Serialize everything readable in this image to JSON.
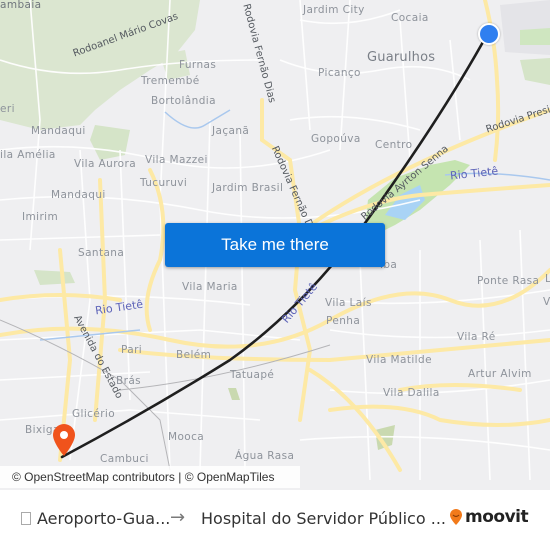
{
  "map": {
    "labels": {
      "cantareira": "ambaia",
      "rodoanel": "Rodoanel Mário Covas",
      "furnas": "Furnas",
      "tremembe": "Tremembé",
      "bortolandia": "Bortolândia",
      "jacana": "Jaçanã",
      "mandaqui_n": "Mandaqui",
      "eri": "eri",
      "vila_amelia": "ila Amélia",
      "vila_aurora": "Vila Aurora",
      "vila_mazzei": "Vila Mazzei",
      "tucuruvi": "Tucuruvi",
      "jardim_brasil": "Jardim Brasil",
      "mandaqui_s": "Mandaqui",
      "imirim": "Imirim",
      "santana": "Santana",
      "vila_maria": "Vila Maria",
      "rio_tiete_w": "Rio Tietê",
      "avenida_estado": "Avenida do Estado",
      "pari": "Pari",
      "belem": "Belém",
      "bras": "Brás",
      "tatuape": "Tatuapé",
      "glicerio": "Glicério",
      "bixiga": "Bixiga",
      "mooca": "Mooca",
      "cambuci": "Cambuci",
      "agua_rasa": "Água Rasa",
      "jardim_city": "Jardim City",
      "cocaia": "Cocaia",
      "guarulhos": "Guarulhos",
      "picanco": "Picanço",
      "gopouva": "Gopoúva",
      "centro": "Centro",
      "rodovia_presidente": "Rodovia Presid",
      "ayrton_senna": "Rodovia Ayrton Senna",
      "rio_tiete_e": "Rio Tietê",
      "fernao_dias_n": "Rodovia Fernão Dias",
      "fernao_dias_s": "Rodovia Fernão D",
      "iba": "iba",
      "ponte_rasa": "Ponte Rasa",
      "vila_lais": "Vila Laís",
      "penha": "Penha",
      "rio_tiete_c": "Rio Tietê",
      "vila_re": "Vila Ré",
      "vila_matilde": "Vila Matilde",
      "artur_alvim": "Artur Alvim",
      "vila_dalila": "Vila Dalila",
      "edge_l": "L",
      "edge_v": "V"
    },
    "cta_label": "Take me there",
    "attribution": "© OpenStreetMap contributors | © OpenMapTiles",
    "colors": {
      "route": "#1f1f1f",
      "origin_marker": "#2f7ff0",
      "destination_marker": "#f0531c",
      "cta": "#0b74d9",
      "major_road": "#fde9a5",
      "park": "#c5e4b0",
      "forest": "#d8e6cc",
      "water": "#a9d3f5"
    }
  },
  "footer": {
    "origin_icon": "bus-stop-icon",
    "origin": "Aeroporto-Gua...",
    "arrow": "→",
    "destination": "Hospital do Servidor Público ...",
    "brand": "moovit"
  }
}
